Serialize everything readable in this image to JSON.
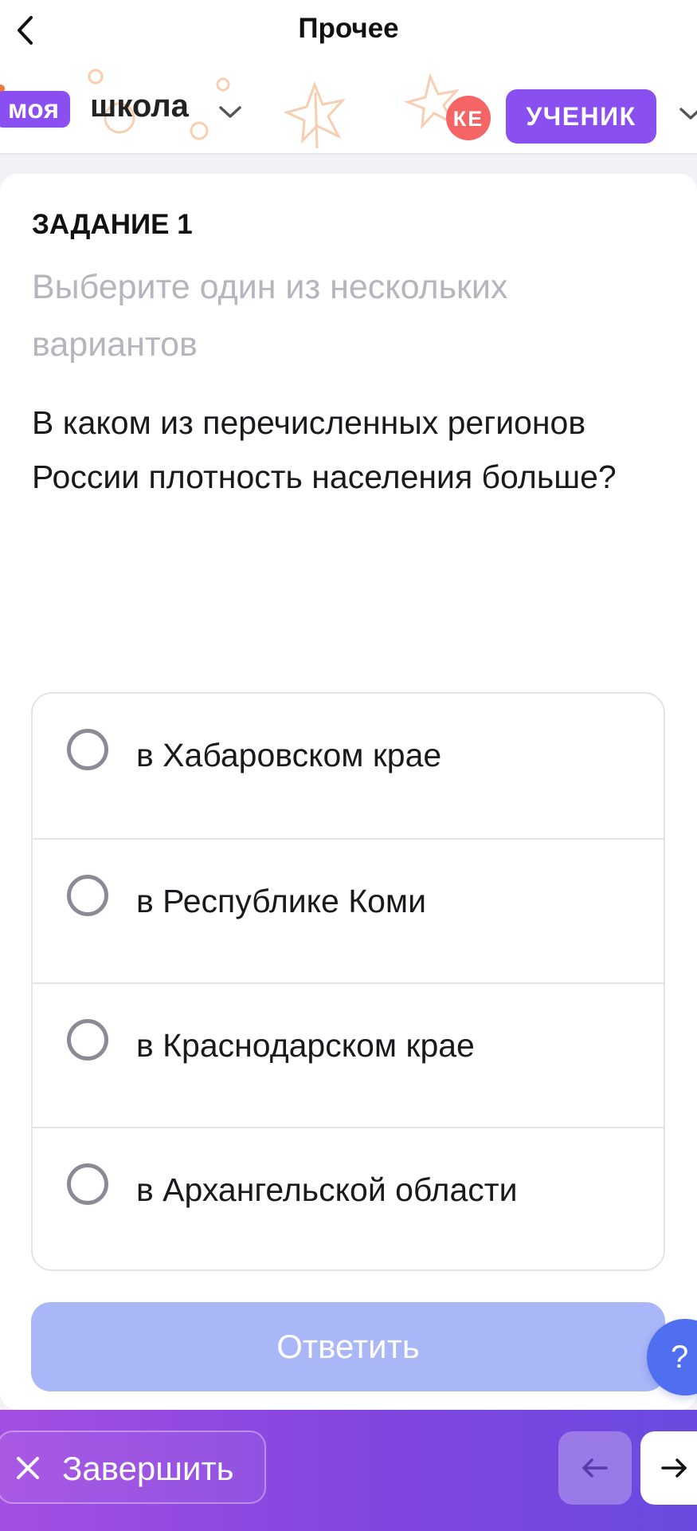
{
  "nav": {
    "title": "Прочее",
    "back_icon": "chevron-left-icon"
  },
  "header": {
    "logo_badge": "моя",
    "logo_text": "школа",
    "avatar_initials": "КЕ",
    "role": "УЧЕНИК"
  },
  "task": {
    "label": "ЗАДАНИЕ 1",
    "hint": "Выберите один из нескольких вариантов",
    "question": "В каком из перечисленных регионов России плотность населения больше?",
    "options": [
      {
        "label": "в Хабаровском крае",
        "selected": false
      },
      {
        "label": "в Республике Коми",
        "selected": false
      },
      {
        "label": "в Краснодарском крае",
        "selected": false
      },
      {
        "label": "в Архангельской области",
        "selected": false
      }
    ],
    "answer_button": "Ответить"
  },
  "help": {
    "label": "?"
  },
  "footer": {
    "finish_label": "Завершить"
  },
  "colors": {
    "accent_purple": "#8a4ff0",
    "avatar_red": "#f56565",
    "answer_disabled": "#a9b6f7",
    "help_blue": "#4f6ef0",
    "hint_gray": "#b5b5bd"
  }
}
